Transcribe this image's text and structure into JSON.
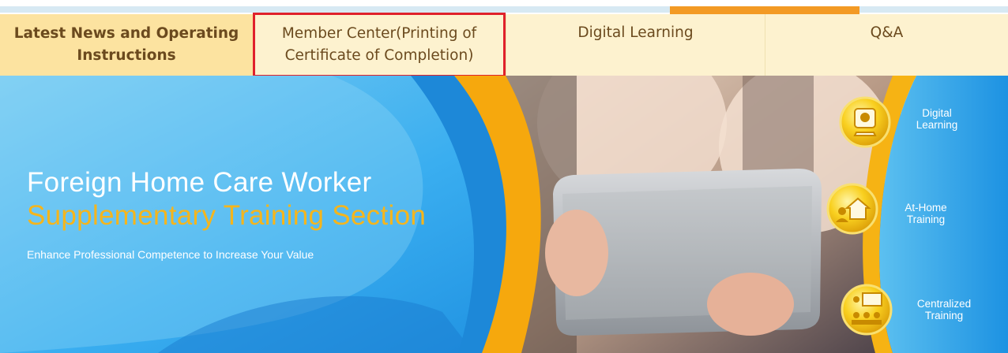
{
  "nav": {
    "items": [
      {
        "line1": "Latest News and Operating",
        "line2": "Instructions"
      },
      {
        "line1": "Member Center(Printing of",
        "line2": "Certificate of Completion)"
      },
      {
        "line1": "Digital Learning",
        "line2": ""
      },
      {
        "line1": "Q&A",
        "line2": ""
      }
    ]
  },
  "hero": {
    "title_line1": "Foreign Home Care Worker",
    "title_line2": "Supplementary Training Section",
    "subtitle": "Enhance Professional Competence to Increase Your Value"
  },
  "services": [
    {
      "line1": "Digital",
      "line2": "Learning",
      "icon": "person-computer-icon"
    },
    {
      "line1": "At-Home",
      "line2": "Training",
      "icon": "person-house-icon"
    },
    {
      "line1": "Centralized",
      "line2": "Training",
      "icon": "classroom-icon"
    }
  ],
  "colors": {
    "highlight_box": "#e0212b",
    "title_accent": "#f5b51c",
    "nav_active_bg": "#fce3a0",
    "nav_bg": "#fdf2cf",
    "top_accent": "#f39a24"
  }
}
